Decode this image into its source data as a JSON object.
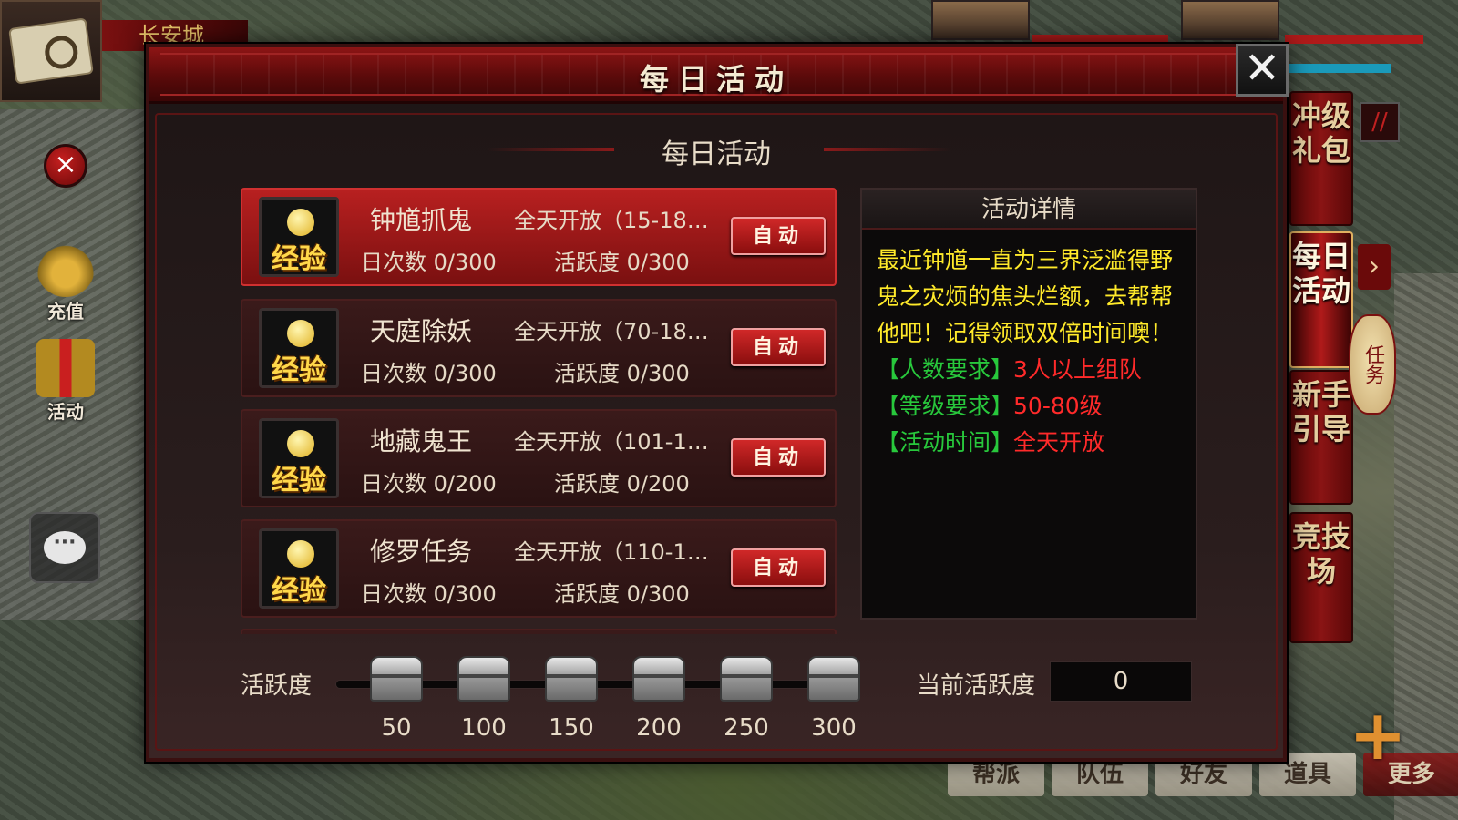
{
  "city": {
    "name": "长安城"
  },
  "left_buttons": {
    "recharge_label": "充值",
    "activity_label": "活动"
  },
  "dialog": {
    "title": "每日活动",
    "subtitle": "每日活动",
    "close_glyph": "✕"
  },
  "activities": [
    {
      "name": "钟馗抓鬼",
      "open": "全天开放（15-180…",
      "count": "日次数 0/300",
      "activity": "活跃度 0/300",
      "badge": "经验",
      "button": "自动",
      "selected": true
    },
    {
      "name": "天庭除妖",
      "open": "全天开放（70-180…",
      "count": "日次数 0/300",
      "activity": "活跃度 0/300",
      "badge": "经验",
      "button": "自动",
      "selected": false
    },
    {
      "name": "地藏鬼王",
      "open": "全天开放（101-18…",
      "count": "日次数 0/200",
      "activity": "活跃度 0/200",
      "badge": "经验",
      "button": "自动",
      "selected": false
    },
    {
      "name": "修罗任务",
      "open": "全天开放（110-18…",
      "count": "日次数 0/300",
      "activity": "活跃度 0/300",
      "badge": "经验",
      "button": "自动",
      "selected": false
    }
  ],
  "detail": {
    "title": "活动详情",
    "description": "最近钟馗一直为三界泛滥得野鬼之灾烦的焦头烂额，去帮帮他吧！记得领取双倍时间噢！",
    "requirements": [
      {
        "key": "【人数要求】",
        "value": "3人以上组队"
      },
      {
        "key": "【等级要求】",
        "value": "50-80级"
      },
      {
        "key": "【活动时间】",
        "value": "全天开放"
      }
    ]
  },
  "activity_bar": {
    "label": "活跃度",
    "milestones": [
      "50",
      "100",
      "150",
      "200",
      "250",
      "300"
    ],
    "current_label": "当前活跃度",
    "current_value": "0"
  },
  "right_tabs": [
    {
      "label": "冲级礼包",
      "active": false
    },
    {
      "label": "每日活动",
      "active": true
    },
    {
      "label": "新手引导",
      "active": false
    },
    {
      "label": "竞技场",
      "active": false
    }
  ],
  "lantern_text": "任务",
  "bottom_menu": [
    "帮派",
    "队伍",
    "好友",
    "道具",
    "更多"
  ],
  "colors": {
    "desc_text": "#ffea2a",
    "req_key": "#28c83c",
    "req_value": "#ff2a2a",
    "selected_row": "#b82020"
  }
}
